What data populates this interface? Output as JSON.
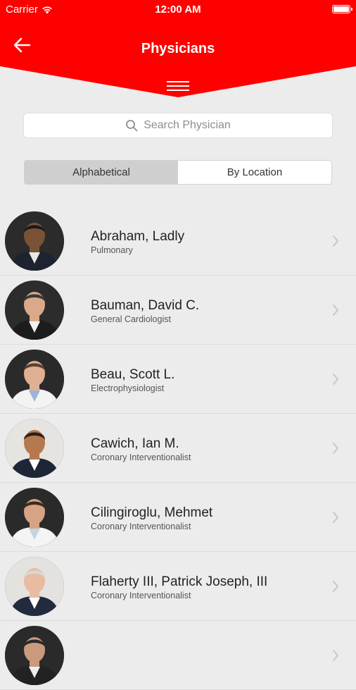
{
  "status": {
    "carrier": "Carrier",
    "time": "12:00 AM"
  },
  "header": {
    "title": "Physicians",
    "accent": "#ff0000"
  },
  "search": {
    "placeholder": "Search Physician"
  },
  "segments": {
    "alphabetical": "Alphabetical",
    "by_location": "By Location",
    "selected": "Alphabetical"
  },
  "physicians": [
    {
      "name": "Abraham, Ladly",
      "specialty": "Pulmonary",
      "skin": "#7a5236",
      "bg": "#2b2b2b",
      "hair": "#1a1a1a",
      "attire": "#1d2330",
      "shirt": "#e8e8e8"
    },
    {
      "name": "Bauman, David C.",
      "specialty": "General Cardiologist",
      "skin": "#d9a98a",
      "bg": "#2c2c2c",
      "hair": "#3a3a3a",
      "attire": "#1c1c1c",
      "shirt": "#f0f0f0"
    },
    {
      "name": "Beau, Scott L.",
      "specialty": "Electrophysiologist",
      "skin": "#e0b094",
      "bg": "#2a2a2a",
      "hair": "#5a4030",
      "attire": "#f3f3f3",
      "shirt": "#9bb4d6"
    },
    {
      "name": "Cawich, Ian M.",
      "specialty": "Coronary Interventionalist",
      "skin": "#b5794f",
      "bg": "#e6e4e0",
      "hair": "#2a1e18",
      "attire": "#1d2536",
      "shirt": "#ffffff"
    },
    {
      "name": "Cilingiroglu, Mehmet",
      "specialty": "Coronary Interventionalist",
      "skin": "#d6a385",
      "bg": "#2a2a2a",
      "hair": "#3b2b22",
      "attire": "#f4f4f4",
      "shirt": "#c5d3e3"
    },
    {
      "name": "Flaherty III, Patrick Joseph, III",
      "specialty": "Coronary Interventionalist",
      "skin": "#e8bca2",
      "bg": "#e4e2de",
      "hair": "#d8d8d8",
      "attire": "#222b3d",
      "shirt": "#ffffff"
    },
    {
      "name": "",
      "specialty": "",
      "skin": "#c99a7c",
      "bg": "#2a2a2a",
      "hair": "#2a2a2a",
      "attire": "#222",
      "shirt": "#eee"
    }
  ]
}
